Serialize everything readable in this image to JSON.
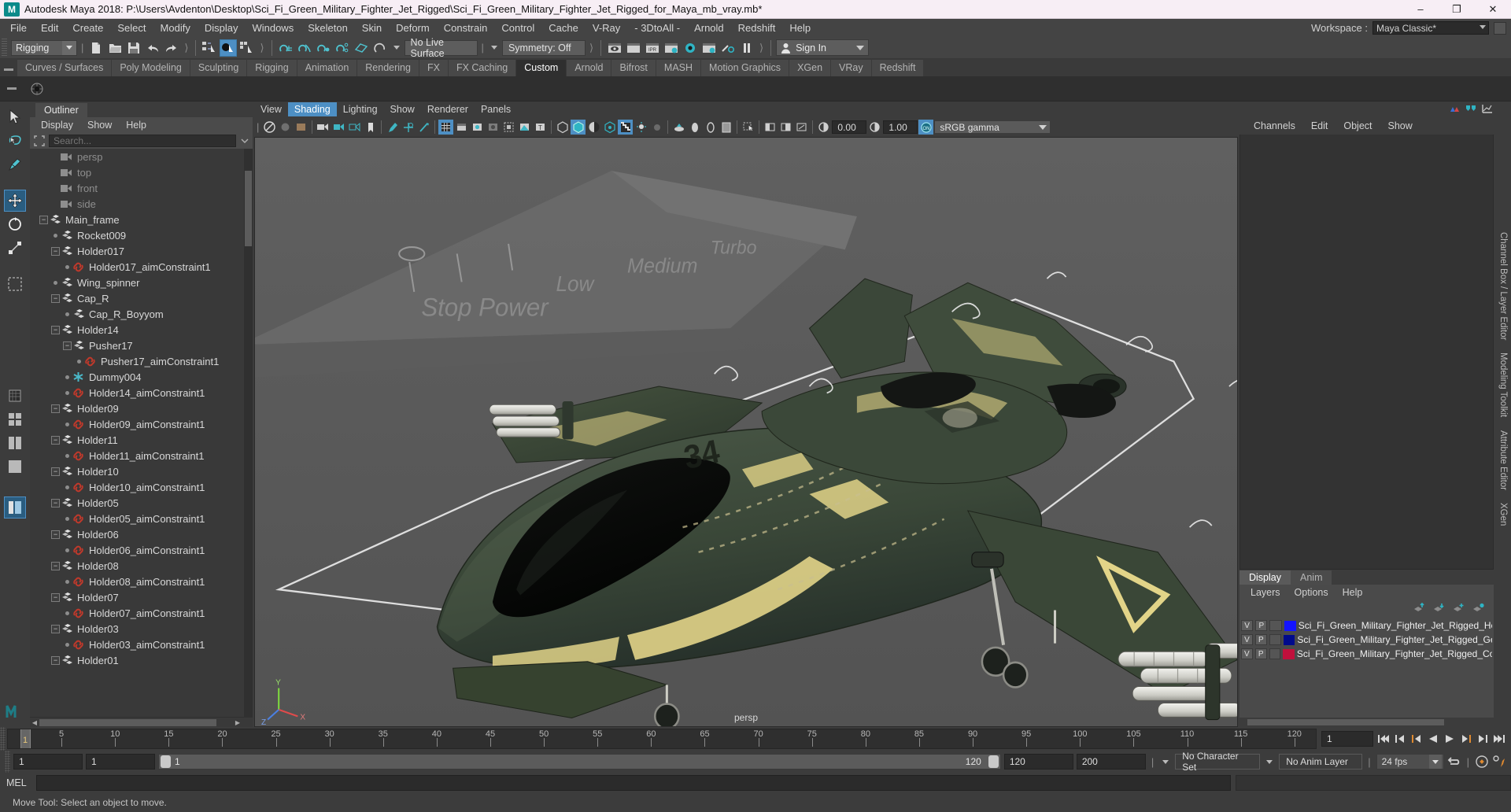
{
  "window": {
    "title": "Autodesk Maya 2018: P:\\Users\\Avdenton\\Desktop\\Sci_Fi_Green_Military_Fighter_Jet_Rigged\\Sci_Fi_Green_Military_Fighter_Jet_Rigged_for_Maya_mb_vray.mb*",
    "logo": "M",
    "minimize": "–",
    "maximize": "❐",
    "close": "✕"
  },
  "menubar": {
    "items": [
      "File",
      "Edit",
      "Create",
      "Select",
      "Modify",
      "Display",
      "Windows",
      "Skeleton",
      "Skin",
      "Deform",
      "Constrain",
      "Control",
      "Cache",
      "V-Ray",
      "- 3DtoAll -",
      "Arnold",
      "Redshift",
      "Help"
    ],
    "workspace_label": "Workspace :",
    "workspace_value": "Maya Classic*"
  },
  "statusbar": {
    "menu_set": "Rigging",
    "live_surface": "No Live Surface",
    "symmetry": "Symmetry: Off",
    "sign_in": "Sign In"
  },
  "shelf": {
    "tabs": [
      "Curves / Surfaces",
      "Poly Modeling",
      "Sculpting",
      "Rigging",
      "Animation",
      "Rendering",
      "FX",
      "FX Caching",
      "Custom",
      "Arnold",
      "Bifrost",
      "MASH",
      "Motion Graphics",
      "XGen",
      "VRay",
      "Redshift"
    ],
    "active_tab": "Custom"
  },
  "outliner": {
    "tab": "Outliner",
    "menus": [
      "Display",
      "Show",
      "Help"
    ],
    "search_placeholder": "Search...",
    "items": [
      {
        "label": "persp",
        "icon": "camera-icon",
        "depth": 1,
        "kind": "camera",
        "handle": "none",
        "dim": true
      },
      {
        "label": "top",
        "icon": "camera-icon",
        "depth": 1,
        "kind": "camera",
        "handle": "none",
        "dim": true
      },
      {
        "label": "front",
        "icon": "camera-icon",
        "depth": 1,
        "kind": "camera",
        "handle": "none",
        "dim": true
      },
      {
        "label": "side",
        "icon": "camera-icon",
        "depth": 1,
        "kind": "camera",
        "handle": "none",
        "dim": true
      },
      {
        "label": "Main_frame",
        "icon": "transform-icon",
        "depth": 0,
        "kind": "transform",
        "handle": "minus",
        "dim": false
      },
      {
        "label": "Rocket009",
        "icon": "transform-icon",
        "depth": 1,
        "kind": "transform",
        "handle": "dot",
        "dim": false
      },
      {
        "label": "Holder017",
        "icon": "transform-icon",
        "depth": 1,
        "kind": "transform",
        "handle": "minus",
        "dim": false
      },
      {
        "label": "Holder017_aimConstraint1",
        "icon": "constraint-icon",
        "depth": 2,
        "kind": "constraint",
        "handle": "dot",
        "dim": false
      },
      {
        "label": "Wing_spinner",
        "icon": "transform-icon",
        "depth": 1,
        "kind": "transform",
        "handle": "dot",
        "dim": false
      },
      {
        "label": "Cap_R",
        "icon": "transform-icon",
        "depth": 1,
        "kind": "transform",
        "handle": "minus",
        "dim": false
      },
      {
        "label": "Cap_R_Boyyom",
        "icon": "transform-icon",
        "depth": 2,
        "kind": "transform",
        "handle": "dot",
        "dim": false
      },
      {
        "label": "Holder14",
        "icon": "transform-icon",
        "depth": 1,
        "kind": "transform",
        "handle": "minus",
        "dim": false
      },
      {
        "label": "Pusher17",
        "icon": "transform-icon",
        "depth": 2,
        "kind": "transform",
        "handle": "minus",
        "dim": false
      },
      {
        "label": "Pusher17_aimConstraint1",
        "icon": "constraint-icon",
        "depth": 3,
        "kind": "constraint",
        "handle": "dot",
        "dim": false
      },
      {
        "label": "Dummy004",
        "icon": "locator-icon",
        "depth": 2,
        "kind": "locator",
        "handle": "dot",
        "dim": false
      },
      {
        "label": "Holder14_aimConstraint1",
        "icon": "constraint-icon",
        "depth": 2,
        "kind": "constraint",
        "handle": "dot",
        "dim": false
      },
      {
        "label": "Holder09",
        "icon": "transform-icon",
        "depth": 1,
        "kind": "transform",
        "handle": "minus",
        "dim": false
      },
      {
        "label": "Holder09_aimConstraint1",
        "icon": "constraint-icon",
        "depth": 2,
        "kind": "constraint",
        "handle": "dot",
        "dim": false
      },
      {
        "label": "Holder11",
        "icon": "transform-icon",
        "depth": 1,
        "kind": "transform",
        "handle": "minus",
        "dim": false
      },
      {
        "label": "Holder11_aimConstraint1",
        "icon": "constraint-icon",
        "depth": 2,
        "kind": "constraint",
        "handle": "dot",
        "dim": false
      },
      {
        "label": "Holder10",
        "icon": "transform-icon",
        "depth": 1,
        "kind": "transform",
        "handle": "minus",
        "dim": false
      },
      {
        "label": "Holder10_aimConstraint1",
        "icon": "constraint-icon",
        "depth": 2,
        "kind": "constraint",
        "handle": "dot",
        "dim": false
      },
      {
        "label": "Holder05",
        "icon": "transform-icon",
        "depth": 1,
        "kind": "transform",
        "handle": "minus",
        "dim": false
      },
      {
        "label": "Holder05_aimConstraint1",
        "icon": "constraint-icon",
        "depth": 2,
        "kind": "constraint",
        "handle": "dot",
        "dim": false
      },
      {
        "label": "Holder06",
        "icon": "transform-icon",
        "depth": 1,
        "kind": "transform",
        "handle": "minus",
        "dim": false
      },
      {
        "label": "Holder06_aimConstraint1",
        "icon": "constraint-icon",
        "depth": 2,
        "kind": "constraint",
        "handle": "dot",
        "dim": false
      },
      {
        "label": "Holder08",
        "icon": "transform-icon",
        "depth": 1,
        "kind": "transform",
        "handle": "minus",
        "dim": false
      },
      {
        "label": "Holder08_aimConstraint1",
        "icon": "constraint-icon",
        "depth": 2,
        "kind": "constraint",
        "handle": "dot",
        "dim": false
      },
      {
        "label": "Holder07",
        "icon": "transform-icon",
        "depth": 1,
        "kind": "transform",
        "handle": "minus",
        "dim": false
      },
      {
        "label": "Holder07_aimConstraint1",
        "icon": "constraint-icon",
        "depth": 2,
        "kind": "constraint",
        "handle": "dot",
        "dim": false
      },
      {
        "label": "Holder03",
        "icon": "transform-icon",
        "depth": 1,
        "kind": "transform",
        "handle": "minus",
        "dim": false
      },
      {
        "label": "Holder03_aimConstraint1",
        "icon": "constraint-icon",
        "depth": 2,
        "kind": "constraint",
        "handle": "dot",
        "dim": false
      },
      {
        "label": "Holder01",
        "icon": "transform-icon",
        "depth": 1,
        "kind": "transform",
        "handle": "minus",
        "dim": false
      }
    ]
  },
  "viewport": {
    "menus": [
      "View",
      "Shading",
      "Lighting",
      "Show",
      "Renderer",
      "Panels"
    ],
    "active_menu": "Shading",
    "exposure": "0.00",
    "gamma_value": "1.00",
    "color_space": "sRGB gamma",
    "camera_label": "persp",
    "scene_text": {
      "stop_power": "Stop Power",
      "low": "Low",
      "medium": "Medium",
      "turbo": "Turbo",
      "tail_number": "34"
    },
    "axis_labels": {
      "y": "Y",
      "x": "X",
      "z": "Z"
    }
  },
  "channelbox": {
    "menus": [
      "Channels",
      "Edit",
      "Object",
      "Show"
    ],
    "side_tabs": [
      "Channel Box / Layer Editor",
      "Modeling Toolkit",
      "Attribute Editor",
      "XGen"
    ]
  },
  "layers": {
    "tabs": [
      "Display",
      "Anim"
    ],
    "active_tab": "Display",
    "menus": [
      "Layers",
      "Options",
      "Help"
    ],
    "rows": [
      {
        "v": "V",
        "p": "P",
        "color": "#1414ff",
        "name": "Sci_Fi_Green_Military_Fighter_Jet_Rigged_Help"
      },
      {
        "v": "V",
        "p": "P",
        "color": "#000a8c",
        "name": "Sci_Fi_Green_Military_Fighter_Jet_Rigged_Geom"
      },
      {
        "v": "V",
        "p": "P",
        "color": "#c0103c",
        "name": "Sci_Fi_Green_Military_Fighter_Jet_Rigged_Contro"
      }
    ]
  },
  "timeline": {
    "ticks": [
      5,
      10,
      15,
      20,
      25,
      30,
      35,
      40,
      45,
      50,
      55,
      60,
      65,
      70,
      75,
      80,
      85,
      90,
      95,
      100,
      105,
      110,
      115,
      120
    ],
    "current_frame_marker": "1",
    "current_frame_field": "1",
    "range_start": "1",
    "range_end": "1",
    "slider_start": "1",
    "slider_end": "120",
    "anim_end": "120",
    "playback_end": "200",
    "character_set": "No Character Set",
    "anim_layer": "No Anim Layer",
    "fps": "24 fps"
  },
  "mel": {
    "label": "MEL",
    "input_value": ""
  },
  "status": {
    "message": "Move Tool: Select an object to move."
  },
  "colors": {
    "accent": "#4d8fc4",
    "panel": "#3c3c3c",
    "viewport_bg": "#5a5a5a",
    "jet_body": "#3d4a3a",
    "jet_stripe": "#e6d98a"
  }
}
